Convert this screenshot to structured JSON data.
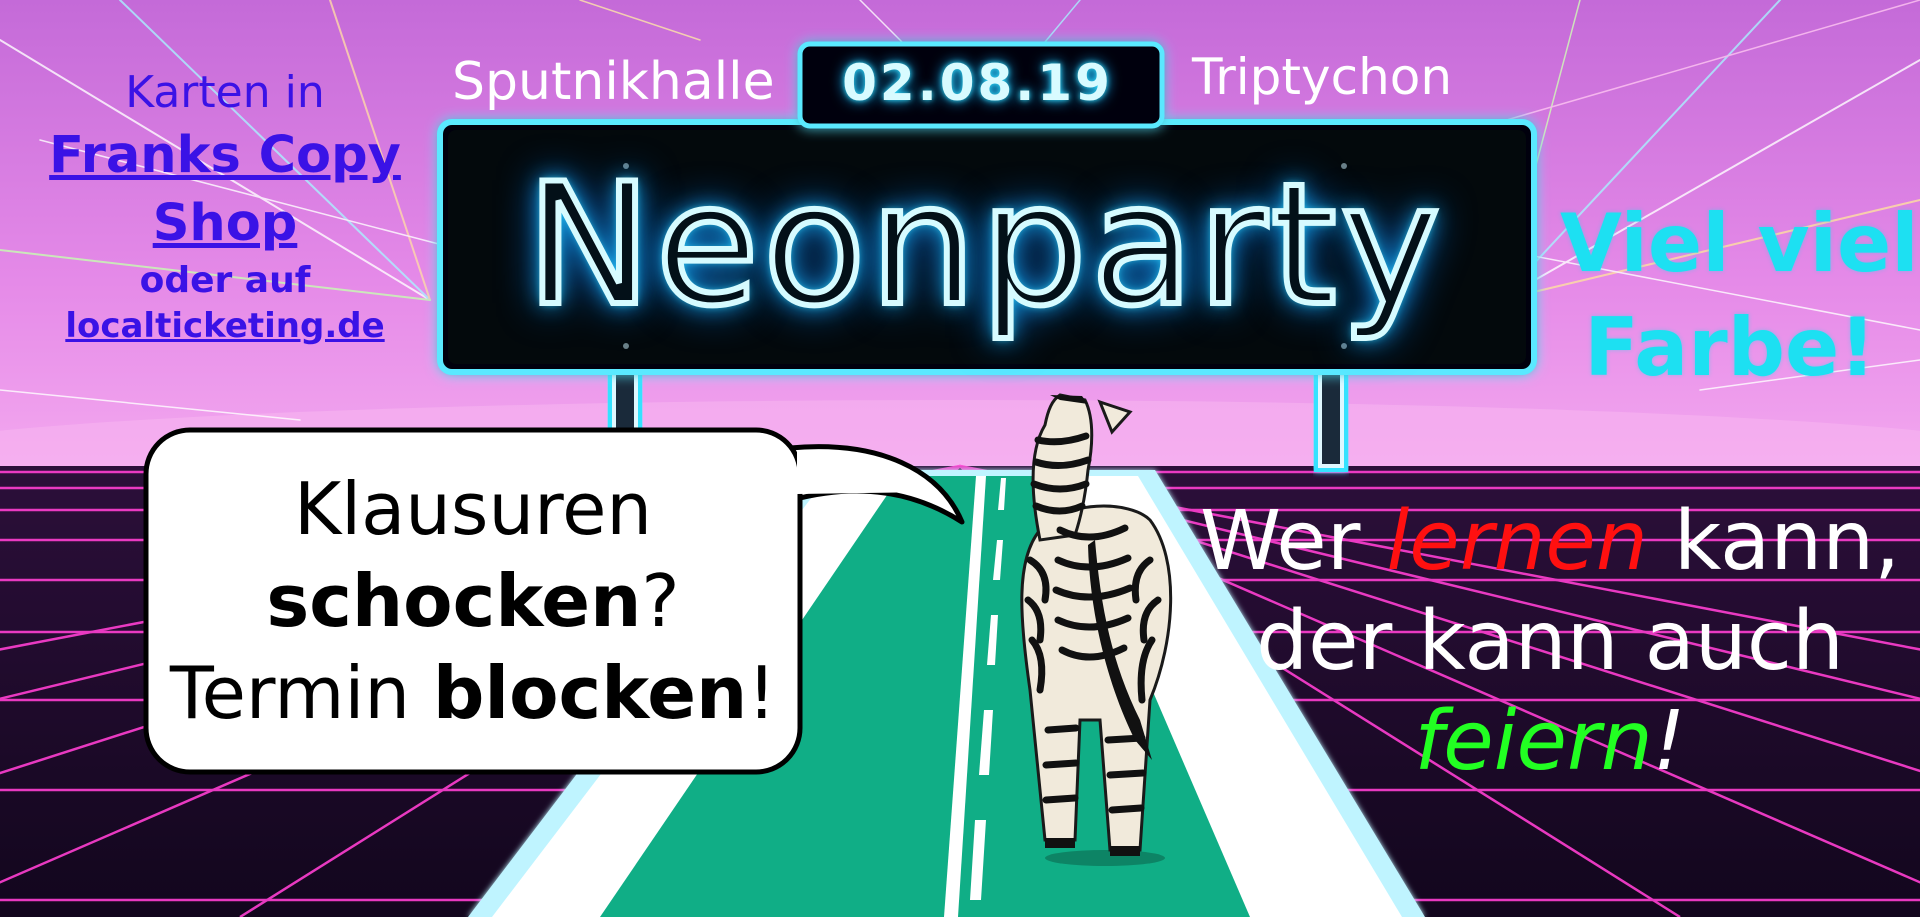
{
  "colors": {
    "sky_top": "#d86fdc",
    "sky_bottom": "#ef9ff0",
    "grid_line": "#ff3fd2",
    "floor_base": "#160824",
    "road_green": "#10ae86",
    "neon_cyan": "#35e2ff",
    "link_blue": "#3a12e6",
    "highlight_red": "#ff1010",
    "highlight_green": "#22ff22",
    "accent_cyan_text": "#1de0f2"
  },
  "tickets": {
    "prefix": "Karten in",
    "shop_link": "Franks Copy Shop",
    "middle": "oder auf",
    "web_link": "localticketing.de"
  },
  "sign": {
    "venue": "Sputnikhalle",
    "date": "02.08.19",
    "band": "Triptychon",
    "title": "Neonparty"
  },
  "side_text": {
    "line1": "Viel viel",
    "line2": "Farbe!"
  },
  "bubble": {
    "line1": "Klausuren",
    "line2_bold": "schocken",
    "line2_end": "?",
    "line3_start": "Termin ",
    "line3_bold": "blocken",
    "line3_end": "!"
  },
  "slogan": {
    "w1": "Wer ",
    "w2_red": "lernen",
    "w3": " kann,",
    "line2": "der kann auch",
    "w4_green": "feiern",
    "w5": "!"
  },
  "icons": {
    "mascot": "zebra-icon",
    "fireworks": "firework-rays-icon"
  }
}
